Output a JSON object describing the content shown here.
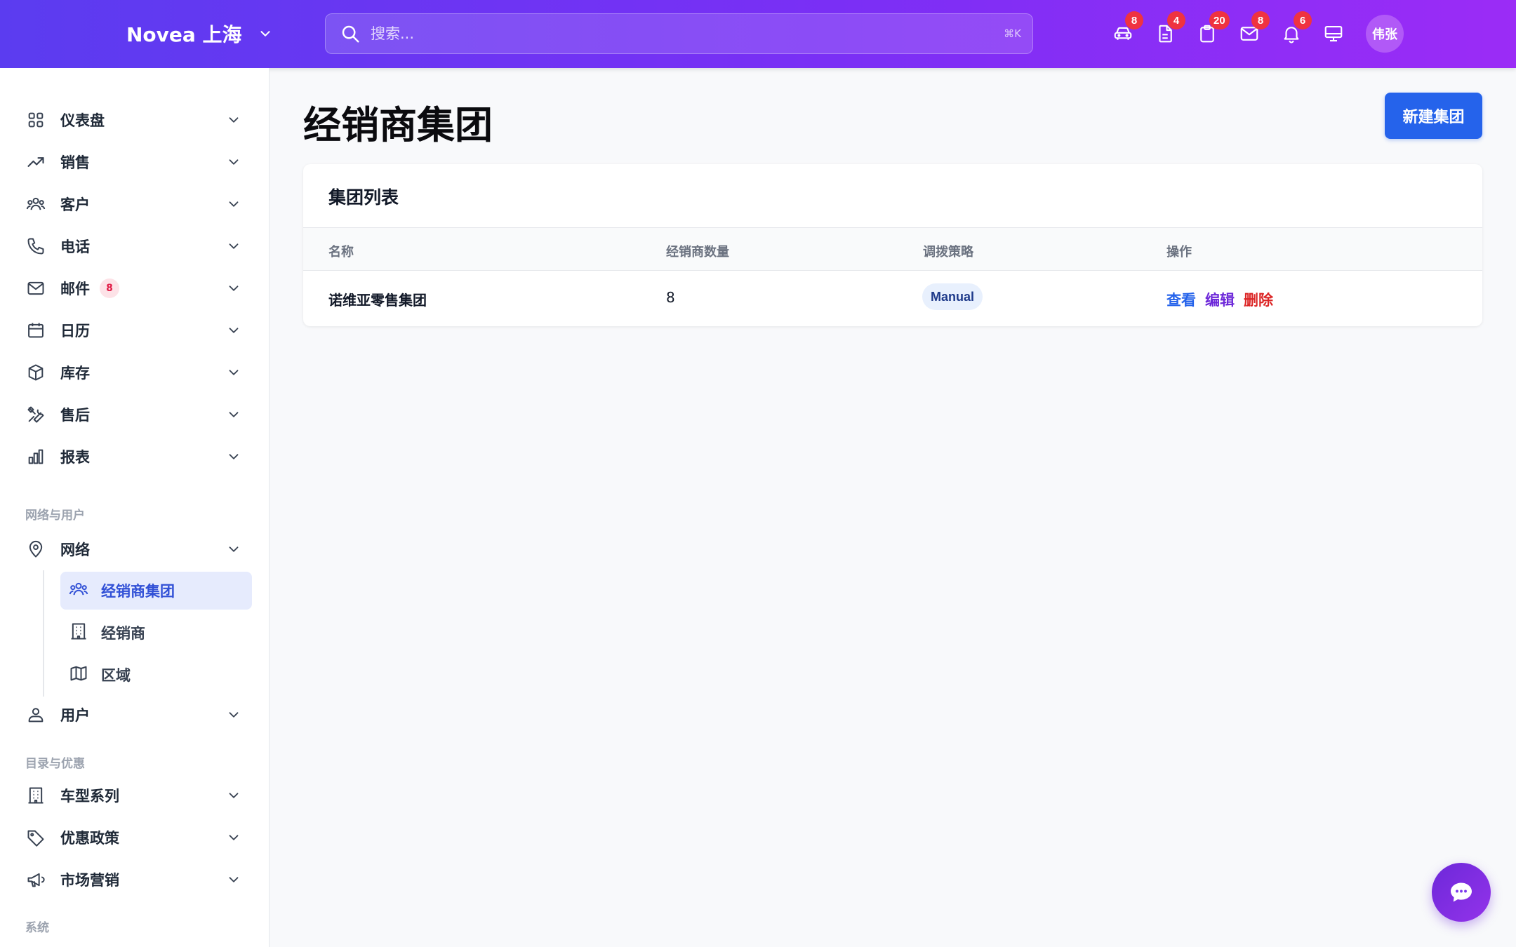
{
  "header": {
    "brand": "Novea 上海",
    "search_placeholder": "搜索...",
    "search_shortcut": "⌘K",
    "icons": [
      {
        "name": "car-icon",
        "badge": "8"
      },
      {
        "name": "document-icon",
        "badge": "4"
      },
      {
        "name": "clipboard-icon",
        "badge": "20"
      },
      {
        "name": "mail-icon",
        "badge": "8"
      },
      {
        "name": "bell-icon",
        "badge": "6"
      },
      {
        "name": "monitor-icon",
        "badge": ""
      }
    ],
    "avatar": "伟张"
  },
  "sidebar": {
    "items": [
      {
        "label": "仪表盘",
        "icon": "dashboard-grid-icon"
      },
      {
        "label": "销售",
        "icon": "trending-up-icon"
      },
      {
        "label": "客户",
        "icon": "users-icon"
      },
      {
        "label": "电话",
        "icon": "phone-icon"
      },
      {
        "label": "邮件",
        "icon": "mail-icon",
        "badge": "8"
      },
      {
        "label": "日历",
        "icon": "calendar-icon"
      },
      {
        "label": "库存",
        "icon": "box-icon"
      },
      {
        "label": "售后",
        "icon": "tools-icon"
      },
      {
        "label": "报表",
        "icon": "bar-chart-icon"
      }
    ],
    "section_network": "网络与用户",
    "network": {
      "label": "网络",
      "icon": "map-pin-icon"
    },
    "network_sub": [
      {
        "label": "经销商集团",
        "icon": "users-icon",
        "active": true
      },
      {
        "label": "经销商",
        "icon": "building-icon"
      },
      {
        "label": "区域",
        "icon": "map-icon"
      }
    ],
    "users": {
      "label": "用户",
      "icon": "user-icon"
    },
    "section_catalog": "目录与优惠",
    "catalog": [
      {
        "label": "车型系列",
        "icon": "building-icon"
      },
      {
        "label": "优惠政策",
        "icon": "tag-icon"
      },
      {
        "label": "市场营销",
        "icon": "megaphone-icon"
      }
    ],
    "section_system": "系统"
  },
  "main": {
    "title": "经销商集团",
    "new_button": "新建集团",
    "card_title": "集团列表",
    "columns": [
      "名称",
      "经销商数量",
      "调拨策略",
      "操作"
    ],
    "rows": [
      {
        "name": "诺维亚零售集团",
        "count": "8",
        "policy": "Manual",
        "actions": [
          "查看",
          "编辑",
          "删除"
        ]
      }
    ]
  },
  "colors": {
    "header_gradient_start": "#5b3cf0",
    "header_gradient_end": "#9b2cf6",
    "primary": "#2563eb",
    "view_link": "#2563eb",
    "edit_link": "#6d28d9",
    "delete_link": "#dc2626",
    "badge": "#ef3340"
  }
}
